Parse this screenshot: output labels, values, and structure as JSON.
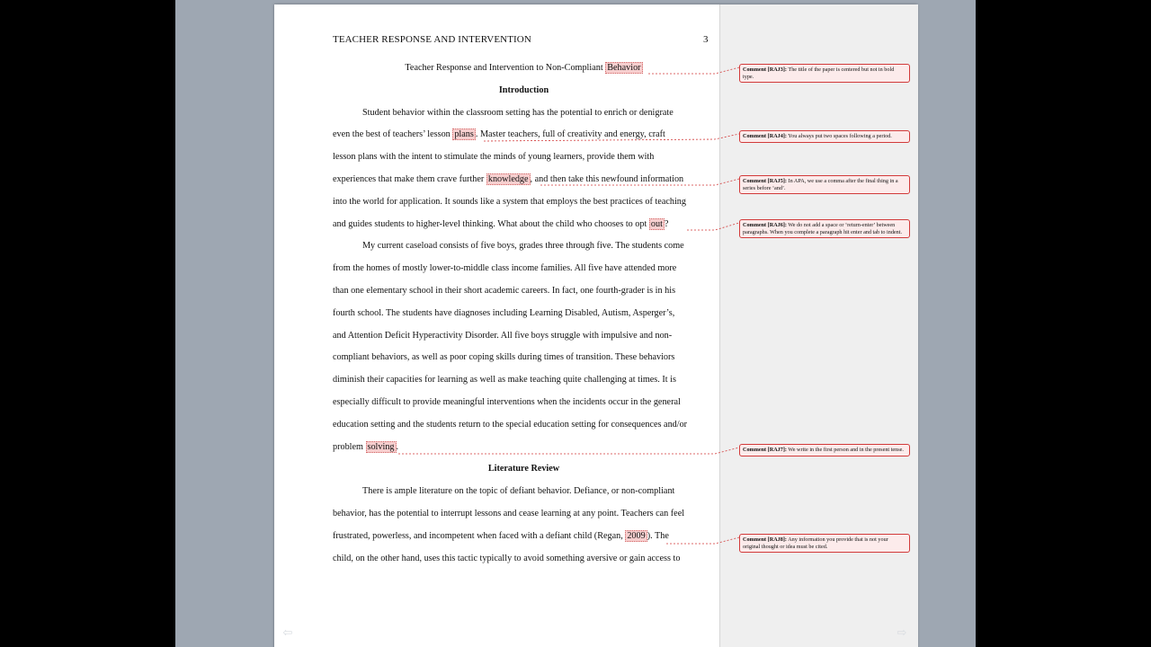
{
  "document": {
    "running_head": "TEACHER RESPONSE AND INTERVENTION",
    "page_number": "3",
    "title_prefix": "Teacher Response and Intervention to Non-Compliant ",
    "title_hl": "Behavior",
    "intro_heading": "Introduction",
    "lit_heading": "Literature Review",
    "p1": {
      "l1": "Student behavior within the classroom setting has the potential to enrich or denigrate",
      "l2a": "even the best of teachers’ lesson ",
      "l2hl": "plans",
      "l2b": ".  Master teachers, full of creativity and energy, craft",
      "l3": "lesson plans with the intent to stimulate the minds of young learners, provide them with",
      "l4a": "experiences that make them crave further ",
      "l4hl": "knowledge",
      "l4b": ", and then take this newfound information",
      "l5": "into the world for application.  It sounds like a system that employs the best practices of teaching",
      "l6a": "and guides students to higher-level thinking.  What about the child who chooses to opt ",
      "l6hl": "out",
      "l6b": "?"
    },
    "p2": {
      "l1": "My current caseload consists of five boys, grades three through five.  The students come",
      "l2": "from the homes of mostly lower-to-middle class income families.  All five have attended more",
      "l3": "than one elementary school in their short academic careers.  In fact, one fourth-grader is in his",
      "l4": "fourth school.  The students have diagnoses including Learning Disabled, Autism, Asperger’s,",
      "l5": "and Attention Deficit Hyperactivity Disorder.  All five boys struggle with impulsive and non-",
      "l6": "compliant behaviors, as well as poor coping skills during times of transition.  These behaviors",
      "l7": "diminish their capacities for learning as well as make teaching quite challenging at times.  It is",
      "l8": "especially difficult to provide meaningful interventions when the incidents occur in the general",
      "l9": "education setting and the students return to the special education setting for consequences and/or",
      "l10a": "problem ",
      "l10hl": "solving",
      "l10b": "."
    },
    "p3": {
      "l1": "There is ample literature on the topic of defiant behavior.  Defiance, or non-compliant",
      "l2": "behavior, has the potential to interrupt lessons and cease learning at any point.  Teachers can feel",
      "l3a": "frustrated, powerless, and incompetent when faced with a defiant child (Regan, ",
      "l3hl": "2009",
      "l3b": ").  The",
      "l4": "child, on the other hand, uses this tactic typically to avoid something aversive or gain access to"
    }
  },
  "comments": [
    {
      "tag": "Comment [RAJ3]:",
      "text": " The title of the paper is centered but not in bold type."
    },
    {
      "tag": "Comment [RAJ4]:",
      "text": " You always put two spaces following a period."
    },
    {
      "tag": "Comment [RAJ5]:",
      "text": " In APA, we use a comma after the final thing in a series before ‘and’."
    },
    {
      "tag": "Comment [RAJ6]:",
      "text": " We do not add a space or ‘return-enter’ between paragraphs.  When you complete a paragraph hit enter and tab to indent."
    },
    {
      "tag": "Comment [RAJ7]:",
      "text": " We write in the first person and in the present tense."
    },
    {
      "tag": "Comment [RAJ8]:",
      "text": " Any information you provide that is not your original thought or idea must be cited."
    }
  ],
  "nav": {
    "prev_icon": "left-arrow-icon",
    "next_icon": "right-arrow-icon"
  },
  "colors": {
    "comment_border": "#d23a3a",
    "comment_fill": "#fcebeb",
    "highlight": "#f7cfcf"
  }
}
